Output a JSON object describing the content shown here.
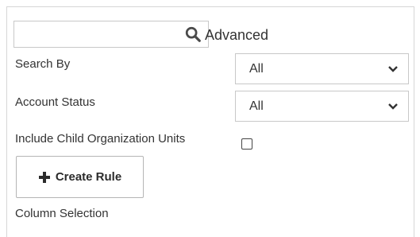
{
  "search": {
    "value": "",
    "placeholder": "",
    "advanced_label": "Advanced"
  },
  "filters": {
    "search_by": {
      "label": "Search By",
      "selected": "All"
    },
    "account_status": {
      "label": "Account Status",
      "selected": "All"
    },
    "include_child": {
      "label": "Include Child Organization Units",
      "checked": false
    }
  },
  "actions": {
    "create_rule_label": "Create Rule"
  },
  "sections": {
    "column_selection_label": "Column Selection"
  },
  "icons": {
    "search": "search-icon",
    "plus": "plus-icon",
    "chevron": "chevron-down-icon"
  }
}
